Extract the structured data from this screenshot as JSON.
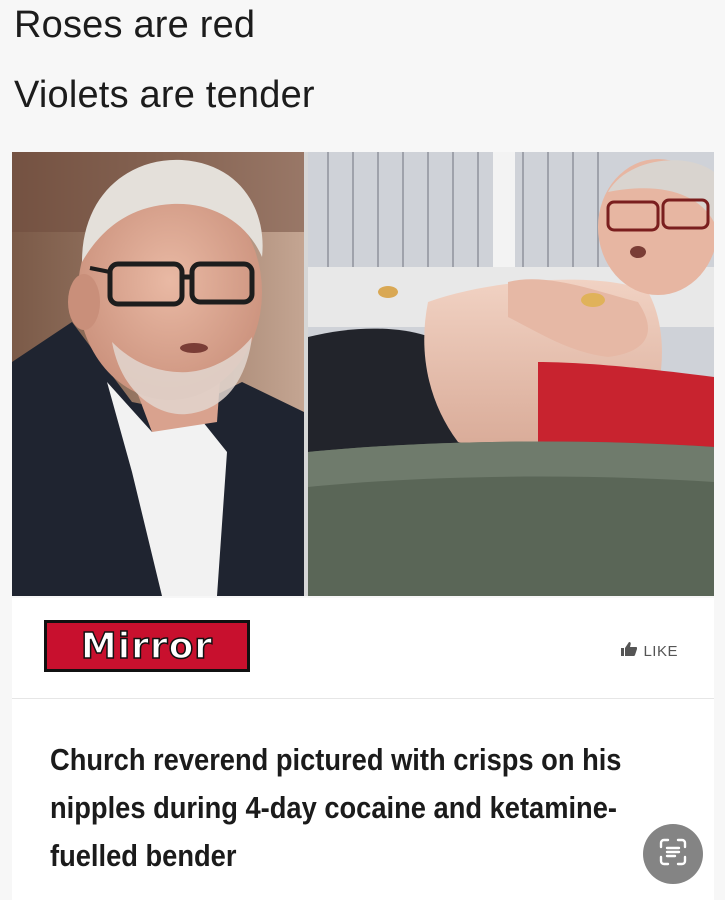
{
  "caption": {
    "line1": "Roses are red",
    "line2": "Violets are tender"
  },
  "photos": {
    "left_icon": "man-in-glasses-photo",
    "right_icon": "man-on-sofa-photo"
  },
  "card": {
    "brand": "Mirror",
    "brand_color": "#c8102e",
    "like_label": "LIKE",
    "like_icon": "thumbs-up-icon",
    "headline": "Church reverend pictured with crisps on his nipples during 4-day cocaine and ketamine-fuelled bender"
  },
  "overlay": {
    "icon": "text-scan-icon"
  }
}
